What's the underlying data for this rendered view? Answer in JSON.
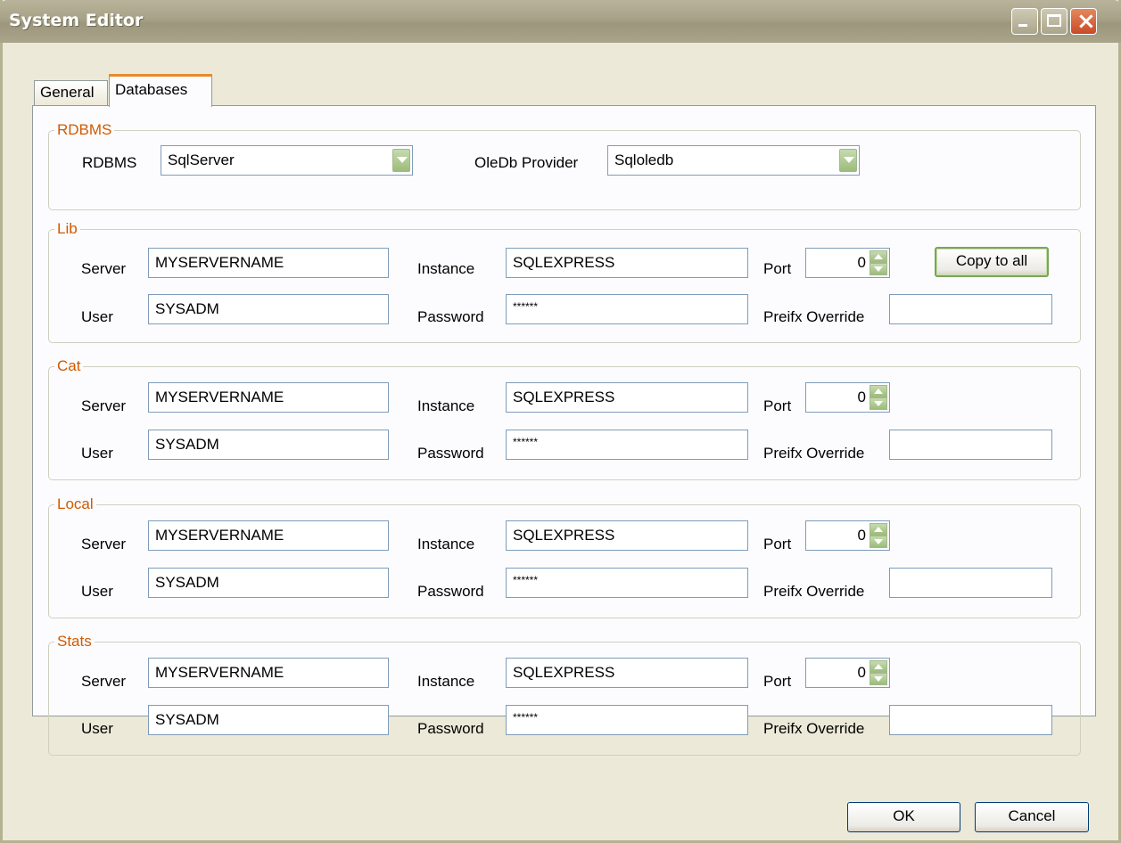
{
  "window": {
    "title": "System Editor"
  },
  "tabs": [
    {
      "label": "General"
    },
    {
      "label": "Databases"
    }
  ],
  "rdbms": {
    "legend": "RDBMS",
    "rdbms_label": "RDBMS",
    "rdbms_value": "SqlServer",
    "provider_label": "OleDb Provider",
    "provider_value": "Sqloledb"
  },
  "labels": {
    "server": "Server",
    "instance": "Instance",
    "port": "Port",
    "user": "User",
    "password": "Password",
    "prefix_override": "Preifx Override"
  },
  "copy_button": "Copy to all",
  "groups": [
    {
      "legend": "Lib",
      "server": "MYSERVERNAME",
      "instance": "SQLEXPRESS",
      "port": "0",
      "user": "SYSADM",
      "password": "******",
      "prefix": ""
    },
    {
      "legend": "Cat",
      "server": "MYSERVERNAME",
      "instance": "SQLEXPRESS",
      "port": "0",
      "user": "SYSADM",
      "password": "******",
      "prefix": ""
    },
    {
      "legend": "Local",
      "server": "MYSERVERNAME",
      "instance": "SQLEXPRESS",
      "port": "0",
      "user": "SYSADM",
      "password": "******",
      "prefix": ""
    },
    {
      "legend": "Stats",
      "server": "MYSERVERNAME",
      "instance": "SQLEXPRESS",
      "port": "0",
      "user": "SYSADM",
      "password": "******",
      "prefix": ""
    }
  ],
  "footer": {
    "ok": "OK",
    "cancel": "Cancel"
  }
}
